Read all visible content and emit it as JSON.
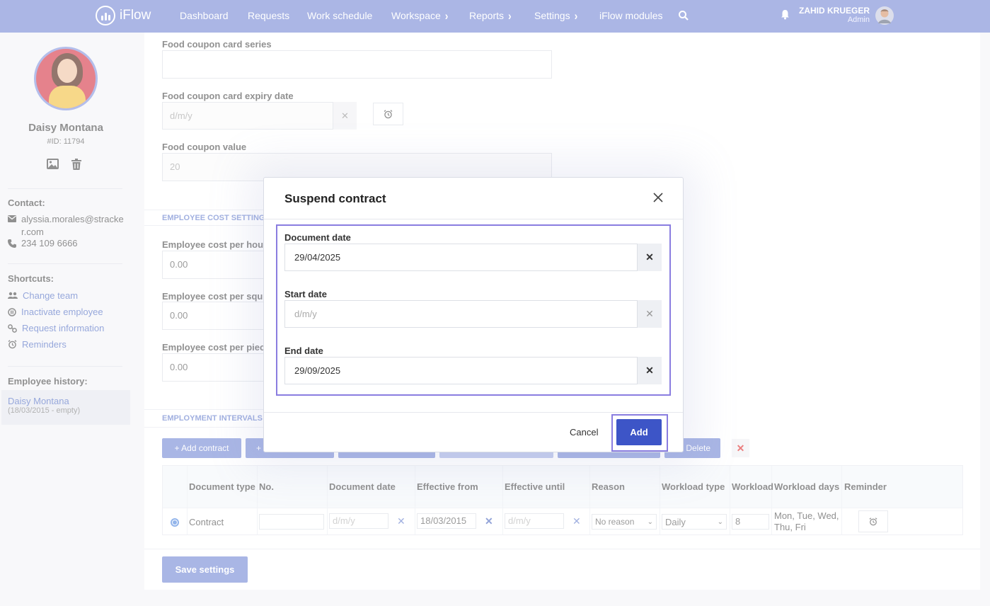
{
  "nav": {
    "logo": "iFlow",
    "items": [
      {
        "label": "Dashboard",
        "chevron": false
      },
      {
        "label": "Requests",
        "chevron": false
      },
      {
        "label": "Work schedule",
        "chevron": false
      },
      {
        "label": "Workspace",
        "chevron": true
      },
      {
        "label": "Reports",
        "chevron": true
      },
      {
        "label": "Settings",
        "chevron": true
      },
      {
        "label": "iFlow modules",
        "chevron": false
      }
    ],
    "user_name": "ZAHID KRUEGER",
    "user_role": "Admin"
  },
  "sidebar": {
    "employee_name": "Daisy Montana",
    "employee_id": "#ID: 11794",
    "contact_title": "Contact:",
    "email": "alyssia.morales@stracker.com",
    "phone": "234 109 6666",
    "shortcuts_title": "Shortcuts:",
    "shortcuts": [
      "Change team",
      "Inactivate employee",
      "Request information",
      "Reminders"
    ],
    "history_title": "Employee history:",
    "history_name": "Daisy Montana",
    "history_range": "(18/03/2015 - empty)"
  },
  "form": {
    "card_series_label": "Food coupon card series",
    "card_series_value": "",
    "expiry_label": "Food coupon card expiry date",
    "expiry_placeholder": "d/m/y",
    "coupon_value_label": "Food coupon value",
    "coupon_value": "20",
    "cost_section": "EMPLOYEE COST SETTINGS",
    "cost_hour_label": "Employee cost per hou",
    "cost_hour_value": "0.00",
    "cost_sq_label": "Employee cost per squ",
    "cost_sq_value": "0.00",
    "cost_piece_label": "Employee cost per piec",
    "cost_piece_value": "0.00",
    "intervals_section": "EMPLOYMENT INTERVALS",
    "add_contract": "+  Add contract",
    "add_other": "+",
    "delete": "Delete",
    "save": "Save settings"
  },
  "table": {
    "headers": [
      "Document type",
      "No.",
      "Document date",
      "Effective from",
      "Effective until",
      "Reason",
      "Workload type",
      "Workload",
      "Workload days",
      "Reminder"
    ],
    "row": {
      "type": "Contract",
      "no": "",
      "doc_date_placeholder": "d/m/y",
      "effective_from": "18/03/2015",
      "effective_until_placeholder": "d/m/y",
      "reason": "No reason",
      "workload_type": "Daily",
      "workload": "8",
      "workload_days_line1": "Mon, Tue, Wed,",
      "workload_days_line2": "Thu, Fri"
    }
  },
  "modal": {
    "title": "Suspend contract",
    "document_date_label": "Document date",
    "document_date": "29/04/2025",
    "start_date_label": "Start date",
    "start_date_placeholder": "d/m/y",
    "end_date_label": "End date",
    "end_date": "29/09/2025",
    "cancel": "Cancel",
    "add": "Add"
  },
  "colors": {
    "nav": "#7e90d8",
    "accent": "#3d55c7",
    "highlight": "#8a7de0",
    "delete_x": "#e03a3a"
  }
}
